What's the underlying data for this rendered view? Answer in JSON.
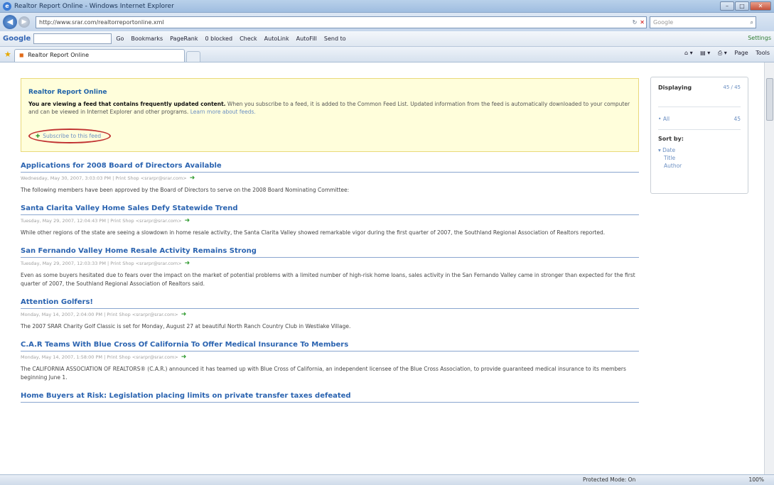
{
  "window": {
    "title": "Realtor Report Online - Windows Internet Explorer"
  },
  "address": {
    "url": "http://www.srar.com/realtorreportonline.xml",
    "search_placeholder": "Google"
  },
  "google_toolbar": {
    "logo": "Google",
    "items": [
      "Go",
      "Bookmarks",
      "PageRank",
      "0 blocked",
      "Check",
      "AutoLink",
      "AutoFill",
      "Send to"
    ],
    "settings": "Settings"
  },
  "tab": {
    "label": "Realtor Report Online"
  },
  "command_bar": {
    "page": "Page",
    "tools": "Tools"
  },
  "banner": {
    "title": "Realtor Report Online",
    "desc_bold": "You are viewing a feed that contains frequently updated content.",
    "desc_rest": " When you subscribe to a feed, it is added to the Common Feed List. Updated information from the feed is automatically downloaded to your computer and can be viewed in Internet Explorer and other programs.",
    "learn_more": "Learn more about feeds.",
    "subscribe": "Subscribe to this feed"
  },
  "articles": [
    {
      "title": "Applications for 2008 Board of Directors Available",
      "meta": "Wednesday, May 30, 2007, 3:03:03 PM | Print Shop <srarpr@srar.com>",
      "body": "The following members have been approved by the Board of Directors to serve on the 2008 Board Nominating Committee:"
    },
    {
      "title": "Santa Clarita Valley Home Sales Defy Statewide Trend",
      "meta": "Tuesday, May 29, 2007, 12:04:43 PM | Print Shop <srarpr@srar.com>",
      "body": "While other regions of the state are seeing a slowdown in home resale activity, the Santa Clarita Valley showed remarkable vigor during the first quarter of 2007, the Southland Regional Association of Realtors reported."
    },
    {
      "title": "San Fernando Valley Home Resale Activity Remains Strong",
      "meta": "Tuesday, May 29, 2007, 12:03:33 PM | Print Shop <srarpr@srar.com>",
      "body": "Even as some buyers hesitated due to fears over the impact on the market of potential problems with a limited number of high-risk home loans, sales activity in the San Fernando Valley came in stronger than expected for the first quarter of 2007, the Southland Regional Association of Realtors said."
    },
    {
      "title": "Attention Golfers!",
      "meta": "Monday, May 14, 2007, 2:04:00 PM | Print Shop <srarpr@srar.com>",
      "body": "The 2007 SRAR Charity Golf Classic is set for Monday, August 27 at beautiful North Ranch Country Club in Westlake Village."
    },
    {
      "title": "C.A.R Teams With Blue Cross Of California To Offer Medical Insurance To Members",
      "meta": "Monday, May 14, 2007, 1:58:00 PM | Print Shop <srarpr@srar.com>",
      "body": "The CALIFORNIA ASSOCIATION OF REALTORS® (C.A.R.) announced it has teamed up with Blue Cross of California, an independent licensee of the Blue Cross Association, to provide guaranteed medical insurance to its members beginning June 1."
    },
    {
      "title": "Home Buyers at Risk: Legislation placing limits on private transfer taxes defeated",
      "meta": "",
      "body": ""
    }
  ],
  "sidebar": {
    "displaying_label": "Displaying",
    "displaying_count": "45 / 45",
    "all_label": "All",
    "all_count": "45",
    "sort_label": "Sort by:",
    "sort_options": [
      "Date",
      "Title",
      "Author"
    ]
  },
  "status": {
    "protected_mode": "Protected Mode: On",
    "zoom": "100%"
  },
  "colors": {
    "link": "#2a63b0",
    "banner_bg": "#fffedb",
    "highlight_circle": "#c03131"
  }
}
